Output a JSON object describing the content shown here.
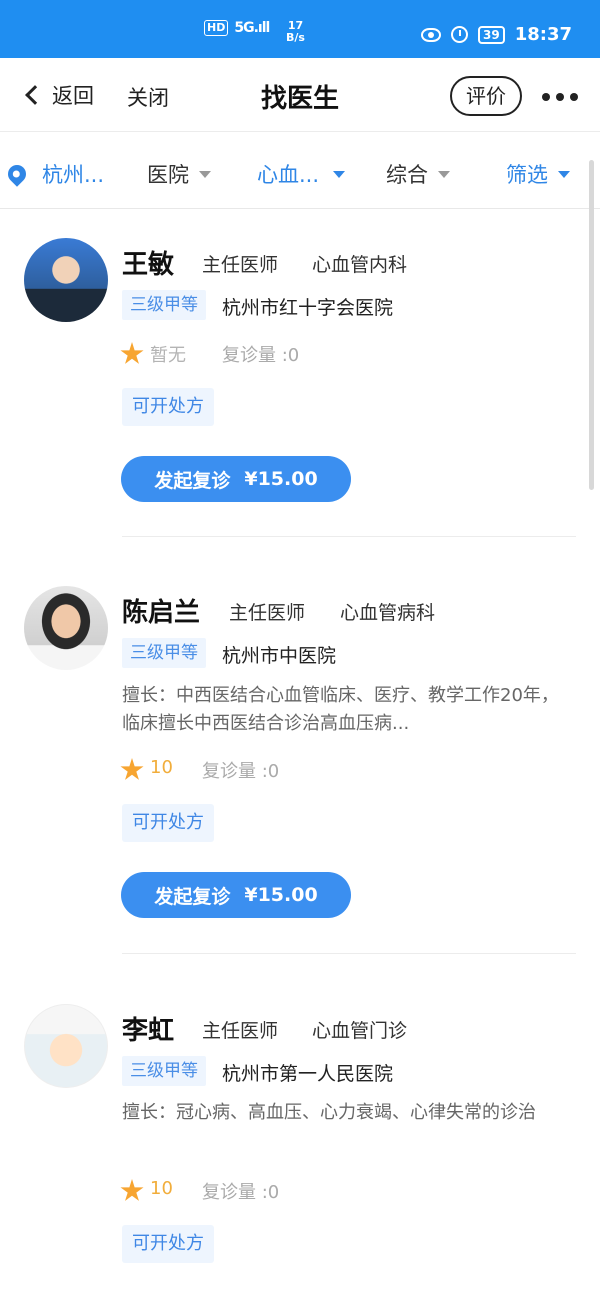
{
  "status_bar": {
    "hd": "HD",
    "signal": "5G.ıll",
    "speed_value": "17",
    "speed_unit": "B/s",
    "battery": "39",
    "time": "18:37"
  },
  "nav": {
    "back_label": "返回",
    "close_label": "关闭",
    "title": "找医生",
    "rate_label": "评价"
  },
  "filters": {
    "location": "杭州...",
    "hospital": "医院",
    "department": "心血...",
    "sort": "综合",
    "screen": "筛选"
  },
  "doctors": [
    {
      "name": "王敏",
      "title": "主任医师",
      "department": "心血管内科",
      "level": "三级甲等",
      "hospital": "杭州市红十字会医院",
      "specialty": "",
      "rating": "暂无",
      "revisits": "复诊量 :0",
      "rx_tag": "可开处方",
      "consult_label": "发起复诊",
      "price": "¥15.00"
    },
    {
      "name": "陈启兰",
      "title": "主任医师",
      "department": "心血管病科",
      "level": "三级甲等",
      "hospital": "杭州市中医院",
      "specialty": "擅长：中西医结合心血管临床、医疗、教学工作20年，临床擅长中西医结合诊治高血压病...",
      "rating": "10",
      "revisits": "复诊量 :0",
      "rx_tag": "可开处方",
      "consult_label": "发起复诊",
      "price": "¥15.00"
    },
    {
      "name": "李虹",
      "title": "主任医师",
      "department": "心血管门诊",
      "level": "三级甲等",
      "hospital": "杭州市第一人民医院",
      "specialty": "擅长：冠心病、高血压、心力衰竭、心律失常的诊治",
      "rating": "10",
      "revisits": "复诊量 :0",
      "rx_tag": "可开处方"
    }
  ]
}
